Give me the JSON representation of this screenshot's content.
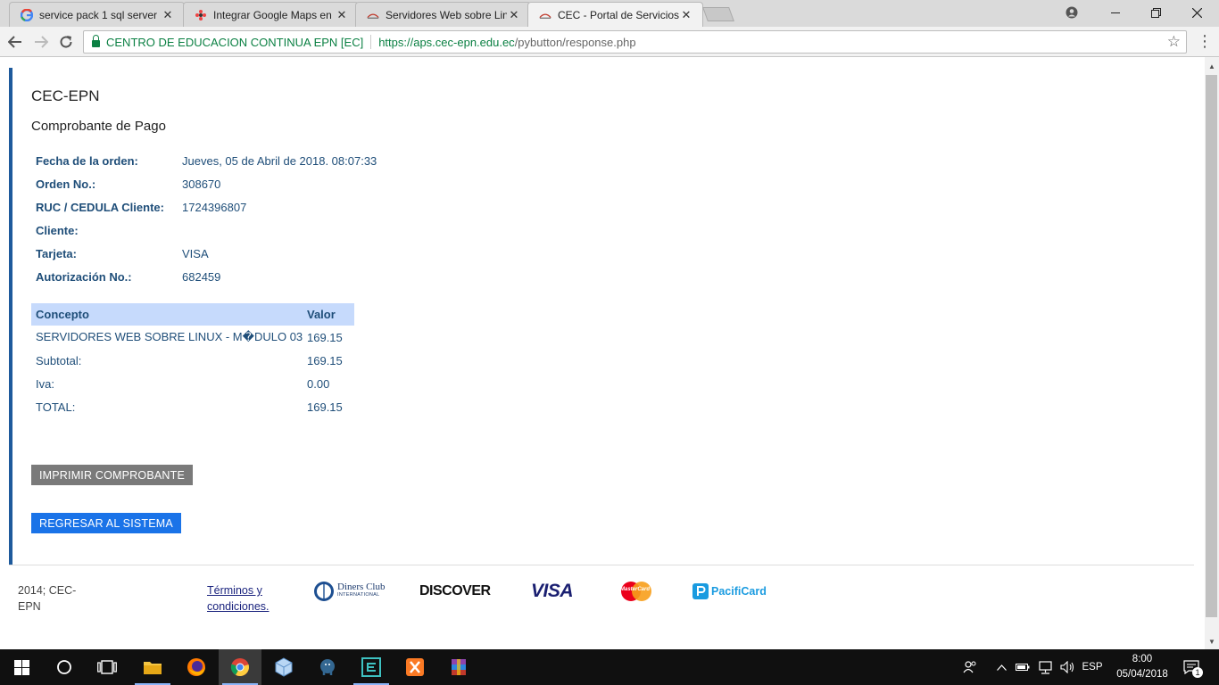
{
  "browser": {
    "tabs": [
      {
        "title": "service pack 1 sql server",
        "active": false,
        "favicon": "google-g-icon"
      },
      {
        "title": "Integrar Google Maps en",
        "active": false,
        "favicon": "joomla-icon"
      },
      {
        "title": "Servidores Web sobre Lin",
        "active": false,
        "favicon": "cec-logo-icon"
      },
      {
        "title": "CEC - Portal de Servicios",
        "active": true,
        "favicon": "cec-logo-icon"
      }
    ],
    "close_glyph": "✕",
    "security_label": "CENTRO DE EDUCACION CONTINUA EPN [EC]",
    "url_scheme_host": "https://aps.cec-epn.edu.ec",
    "url_path": "/pybutton/response.php"
  },
  "page": {
    "heading": "CEC-EPN",
    "subheading": "Comprobante de Pago",
    "order_info": [
      {
        "label": "Fecha de la orden:",
        "value": "Jueves, 05 de Abril de 2018. 08:07:33"
      },
      {
        "label": "Orden No.:",
        "value": "308670"
      },
      {
        "label": "RUC / CEDULA Cliente:",
        "value": "1724396807"
      },
      {
        "label": "Cliente:",
        "value": ""
      },
      {
        "label": "Tarjeta:",
        "value": "VISA"
      },
      {
        "label": "Autorización No.:",
        "value": "682459"
      }
    ],
    "table": {
      "headers": [
        "Concepto",
        "Valor"
      ],
      "rows": [
        {
          "concept": "SERVIDORES WEB SOBRE LINUX - M�DULO 03",
          "value": "169.15"
        },
        {
          "concept": "Subtotal:",
          "value": "169.15"
        },
        {
          "concept": "Iva:",
          "value": "0.00"
        },
        {
          "concept": "TOTAL:",
          "value": "169.15"
        }
      ]
    },
    "print_button": "IMPRIMIR COMPROBANTE",
    "back_button": "REGRESAR AL SISTEMA",
    "footer": {
      "copyright": "2014; CEC-EPN",
      "terms_link": "Términos y condiciones.",
      "card_logos": [
        {
          "name": "diners-club-logo",
          "text": "Diners Club",
          "subtext": "INTERNATIONAL"
        },
        {
          "name": "discover-logo",
          "text": "DISCOVER"
        },
        {
          "name": "visa-logo",
          "text": "VISA"
        },
        {
          "name": "mastercard-logo",
          "text": "MasterCard"
        },
        {
          "name": "pacificard-logo",
          "text": "PacifiCard"
        }
      ]
    }
  },
  "taskbar": {
    "language": "ESP",
    "time": "8:00",
    "date": "05/04/2018",
    "notification_count": "1"
  },
  "colors": {
    "accent_bar": "#1e5a9c",
    "label_text": "#1f4e79",
    "table_header": "#c6dafc",
    "print_button": "#7a7a7a",
    "back_button": "#1a73e8",
    "secure_green": "#0b8043"
  }
}
